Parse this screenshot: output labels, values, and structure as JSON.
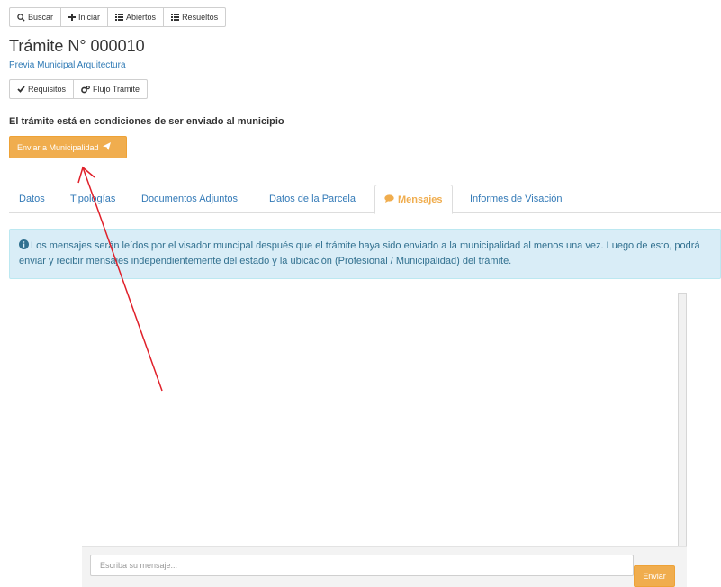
{
  "toolbar": {
    "buscar": "Buscar",
    "iniciar": "Iniciar",
    "abiertos": "Abiertos",
    "resueltos": "Resueltos"
  },
  "tramite": {
    "title": "Trámite N° 000010",
    "subtitle": "Previa Municipal Arquitectura"
  },
  "actions": {
    "requisitos": "Requisitos",
    "flujo": "Flujo Trámite"
  },
  "status": {
    "text": "El trámite está en condiciones de ser enviado al municipio",
    "send_button": "Enviar a Municipalidad"
  },
  "tabs": {
    "datos": "Datos",
    "tipologias": "Tipologías",
    "documentos": "Documentos Adjuntos",
    "parcela": "Datos de la Parcela",
    "mensajes": "Mensajes",
    "informes": "Informes de Visación"
  },
  "info": {
    "text": "Los mensajes serán leídos por el visador muncipal después que el trámite haya sido enviado a la municipalidad al menos una vez. Luego de esto, podrá enviar y recibir mensajes independientemente del estado y la ubicación (Profesional / Municipalidad) del trámite."
  },
  "composer": {
    "placeholder": "Escriba su mensaje...",
    "send": "Enviar"
  },
  "colors": {
    "accent": "#f0ad4e",
    "link": "#337ab7",
    "info_bg": "#d9edf7",
    "annotation_arrow": "#e0202a"
  },
  "icons": [
    "search-icon",
    "plus-icon",
    "list-icon",
    "list-icon",
    "check-icon",
    "cogs-icon",
    "paper-plane-icon",
    "comment-icon",
    "info-circle-icon"
  ]
}
